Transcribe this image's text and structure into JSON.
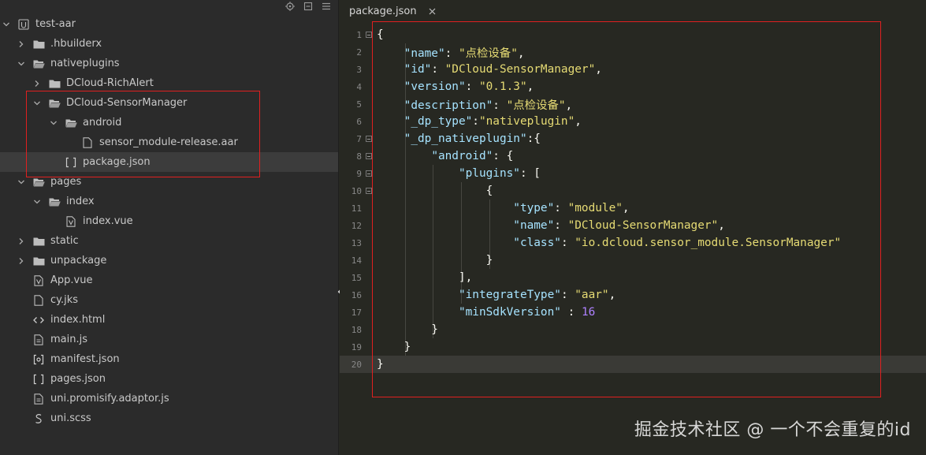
{
  "sidebar": {
    "toolbar": [
      {
        "icon": "locate-icon"
      },
      {
        "icon": "collapse-all-icon"
      },
      {
        "icon": "menu-icon"
      }
    ],
    "items": [
      {
        "label": "test-aar",
        "type": "project",
        "expanded": true
      },
      {
        "label": ".hbuilderx",
        "type": "folder",
        "expanded": false
      },
      {
        "label": "nativeplugins",
        "type": "folder",
        "expanded": true
      },
      {
        "label": "DCloud-RichAlert",
        "type": "folder",
        "expanded": false
      },
      {
        "label": "DCloud-SensorManager",
        "type": "folder",
        "expanded": true
      },
      {
        "label": "android",
        "type": "folder",
        "expanded": true
      },
      {
        "label": "sensor_module-release.aar",
        "type": "file"
      },
      {
        "label": "package.json",
        "type": "json",
        "selected": true
      },
      {
        "label": "pages",
        "type": "folder",
        "expanded": true
      },
      {
        "label": "index",
        "type": "folder",
        "expanded": true
      },
      {
        "label": "index.vue",
        "type": "vue"
      },
      {
        "label": "static",
        "type": "folder",
        "expanded": false
      },
      {
        "label": "unpackage",
        "type": "folder",
        "expanded": false
      },
      {
        "label": "App.vue",
        "type": "vue"
      },
      {
        "label": "cy.jks",
        "type": "file"
      },
      {
        "label": "index.html",
        "type": "html"
      },
      {
        "label": "main.js",
        "type": "js"
      },
      {
        "label": "manifest.json",
        "type": "manifest"
      },
      {
        "label": "pages.json",
        "type": "json"
      },
      {
        "label": "uni.promisify.adaptor.js",
        "type": "js"
      },
      {
        "label": "uni.scss",
        "type": "scss"
      }
    ]
  },
  "editor": {
    "tab": {
      "label": "package.json",
      "close_icon": "close-icon"
    },
    "lines": [
      {
        "num": "1",
        "fold": true,
        "tokens": [
          [
            "p",
            "{"
          ]
        ]
      },
      {
        "num": "2",
        "tokens": [
          [
            "p",
            "    "
          ],
          [
            "k",
            "\"name\""
          ],
          [
            "p",
            ": "
          ],
          [
            "s",
            "\"点检设备\""
          ],
          [
            "p",
            ","
          ]
        ]
      },
      {
        "num": "3",
        "tokens": [
          [
            "p",
            "    "
          ],
          [
            "k",
            "\"id\""
          ],
          [
            "p",
            ": "
          ],
          [
            "s",
            "\"DCloud-SensorManager\""
          ],
          [
            "p",
            ","
          ]
        ]
      },
      {
        "num": "4",
        "tokens": [
          [
            "p",
            "    "
          ],
          [
            "k",
            "\"version\""
          ],
          [
            "p",
            ": "
          ],
          [
            "s",
            "\"0.1.3\""
          ],
          [
            "p",
            ","
          ]
        ]
      },
      {
        "num": "5",
        "tokens": [
          [
            "p",
            "    "
          ],
          [
            "k",
            "\"description\""
          ],
          [
            "p",
            ": "
          ],
          [
            "s",
            "\"点检设备\""
          ],
          [
            "p",
            ","
          ]
        ]
      },
      {
        "num": "6",
        "tokens": [
          [
            "p",
            "    "
          ],
          [
            "k",
            "\"_dp_type\""
          ],
          [
            "p",
            ":"
          ],
          [
            "s",
            "\"nativeplugin\""
          ],
          [
            "p",
            ","
          ]
        ]
      },
      {
        "num": "7",
        "fold": true,
        "tokens": [
          [
            "p",
            "    "
          ],
          [
            "k",
            "\"_dp_nativeplugin\""
          ],
          [
            "p",
            ":{"
          ]
        ]
      },
      {
        "num": "8",
        "fold": true,
        "tokens": [
          [
            "p",
            "        "
          ],
          [
            "k",
            "\"android\""
          ],
          [
            "p",
            ": {"
          ]
        ]
      },
      {
        "num": "9",
        "fold": true,
        "tokens": [
          [
            "p",
            "            "
          ],
          [
            "k",
            "\"plugins\""
          ],
          [
            "p",
            ": ["
          ]
        ]
      },
      {
        "num": "10",
        "fold": true,
        "tokens": [
          [
            "p",
            "                {"
          ]
        ]
      },
      {
        "num": "11",
        "tokens": [
          [
            "p",
            "                    "
          ],
          [
            "k",
            "\"type\""
          ],
          [
            "p",
            ": "
          ],
          [
            "s",
            "\"module\""
          ],
          [
            "p",
            ","
          ]
        ]
      },
      {
        "num": "12",
        "tokens": [
          [
            "p",
            "                    "
          ],
          [
            "k",
            "\"name\""
          ],
          [
            "p",
            ": "
          ],
          [
            "s",
            "\"DCloud-SensorManager\""
          ],
          [
            "p",
            ","
          ]
        ]
      },
      {
        "num": "13",
        "tokens": [
          [
            "p",
            "                    "
          ],
          [
            "k",
            "\"class\""
          ],
          [
            "p",
            ": "
          ],
          [
            "s",
            "\"io.dcloud.sensor_module.SensorManager\""
          ]
        ]
      },
      {
        "num": "14",
        "tokens": [
          [
            "p",
            "                }"
          ]
        ]
      },
      {
        "num": "15",
        "tokens": [
          [
            "p",
            "            ],"
          ]
        ]
      },
      {
        "num": "16",
        "tokens": [
          [
            "p",
            "            "
          ],
          [
            "k",
            "\"integrateType\""
          ],
          [
            "p",
            ": "
          ],
          [
            "s",
            "\"aar\""
          ],
          [
            "p",
            ","
          ]
        ]
      },
      {
        "num": "17",
        "tokens": [
          [
            "p",
            "            "
          ],
          [
            "k",
            "\"minSdkVersion\""
          ],
          [
            "p",
            " : "
          ],
          [
            "n",
            "16"
          ]
        ]
      },
      {
        "num": "18",
        "tokens": [
          [
            "p",
            "        }"
          ]
        ]
      },
      {
        "num": "19",
        "tokens": [
          [
            "p",
            "    }"
          ]
        ]
      },
      {
        "num": "20",
        "current": true,
        "tokens": [
          [
            "p",
            "}"
          ]
        ]
      }
    ]
  },
  "watermark": "掘金技术社区 @ 一个不会重复的id",
  "colors": {
    "highlight_box": "#e02020",
    "string": "#e6db74",
    "key": "#a6e3ff",
    "number": "#ae81ff"
  }
}
